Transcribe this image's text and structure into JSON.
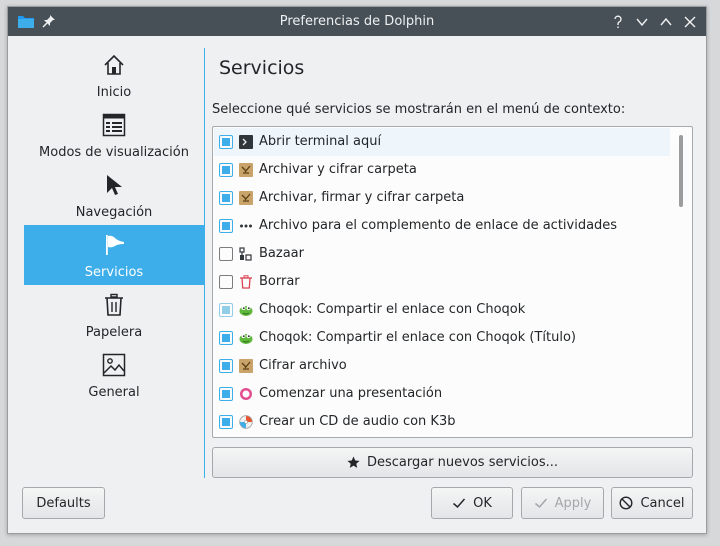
{
  "window": {
    "title": "Preferencias de Dolphin"
  },
  "titlebar_icons": [
    "folder-icon",
    "pin-icon",
    "help-icon",
    "minimize-icon",
    "maximize-icon",
    "close-icon"
  ],
  "sidebar": {
    "items": [
      {
        "label": "Inicio",
        "icon": "home-icon",
        "active": false
      },
      {
        "label": "Modos de visualización",
        "icon": "view-modes-icon",
        "active": false
      },
      {
        "label": "Navegación",
        "icon": "cursor-icon",
        "active": false
      },
      {
        "label": "Servicios",
        "icon": "flag-icon",
        "active": true
      },
      {
        "label": "Papelera",
        "icon": "trash-icon",
        "active": false
      },
      {
        "label": "General",
        "icon": "image-icon",
        "active": false
      }
    ]
  },
  "page": {
    "title": "Servicios",
    "list_label": "Seleccione qué servicios se mostrarán en el menú de contexto:"
  },
  "services": [
    {
      "label": "Abrir terminal aquí",
      "state": "checked",
      "icon": "terminal-icon"
    },
    {
      "label": "Archivar y cifrar carpeta",
      "state": "checked",
      "icon": "archive-encrypt-icon"
    },
    {
      "label": "Archivar, firmar y cifrar carpeta",
      "state": "checked",
      "icon": "archive-sign-icon"
    },
    {
      "label": "Archivo para el complemento de enlace de actividades",
      "state": "checked",
      "icon": "activities-icon"
    },
    {
      "label": "Bazaar",
      "state": "unchecked",
      "icon": "bazaar-icon"
    },
    {
      "label": "Borrar",
      "state": "unchecked",
      "icon": "delete-icon"
    },
    {
      "label": "Choqok: Compartir el enlace con Choqok",
      "state": "partial",
      "icon": "choqok-icon"
    },
    {
      "label": "Choqok: Compartir el enlace con Choqok (Título)",
      "state": "checked",
      "icon": "choqok-icon"
    },
    {
      "label": "Cifrar archivo",
      "state": "checked",
      "icon": "encrypt-file-icon"
    },
    {
      "label": "Comenzar una presentación",
      "state": "checked",
      "icon": "presentation-icon"
    },
    {
      "label": "Crear un CD de audio con K3b",
      "state": "checked",
      "icon": "k3b-icon"
    }
  ],
  "buttons": {
    "download": "Descargar nuevos servicios...",
    "defaults": "Defaults",
    "ok": "OK",
    "apply": "Apply",
    "cancel": "Cancel"
  },
  "colors": {
    "accent": "#3daee9",
    "titlebar": "#475057",
    "window_bg": "#eff0f1",
    "disabled_text": "#a4a7aa"
  }
}
